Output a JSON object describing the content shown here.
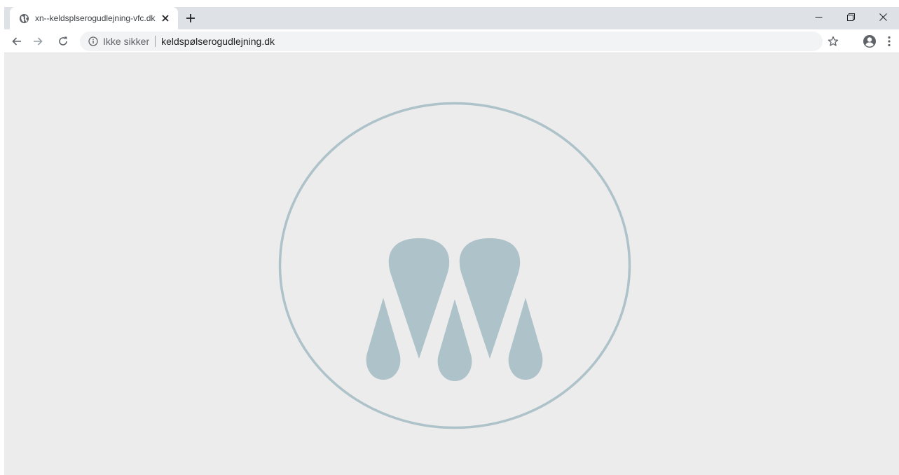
{
  "browser": {
    "tab": {
      "title": "xn--keldsplserogudlejning-vfc.dk",
      "favicon": "globe-icon",
      "close_label": "✕"
    },
    "new_tab": "plus-icon",
    "window_controls": [
      "minimize-icon",
      "restore-icon",
      "close-icon"
    ],
    "nav": [
      "back-arrow-icon",
      "forward-arrow-icon",
      "reload-icon"
    ],
    "omnibox": {
      "security_label": "Ikke sikker",
      "url": "keldspølserogudlejning.dk"
    },
    "toolbar_icons": [
      "star-icon",
      "profile-icon",
      "kebab-menu-icon"
    ]
  },
  "page": {
    "logo": "drops-logo-icon"
  },
  "colors": {
    "tabstrip": "#dee1e6",
    "page_background": "#ececec",
    "logo": "#adc2c9",
    "icon": "#5f6368"
  }
}
